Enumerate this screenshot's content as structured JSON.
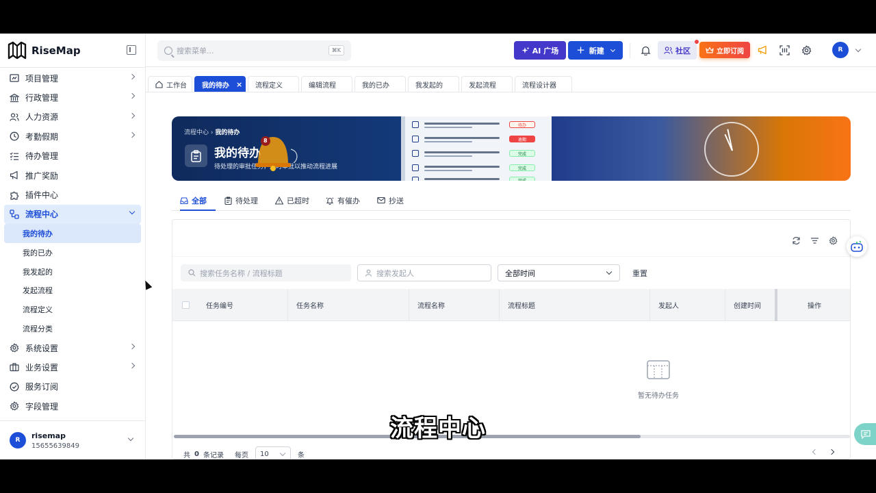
{
  "app": {
    "name": "RiseMap"
  },
  "sidebar": {
    "items": [
      {
        "label": "项目管理",
        "icon": "project-icon"
      },
      {
        "label": "行政管理",
        "icon": "bank-icon"
      },
      {
        "label": "人力资源",
        "icon": "users-icon"
      },
      {
        "label": "考勤假期",
        "icon": "clock-icon"
      },
      {
        "label": "待办管理",
        "icon": "checklist-icon"
      },
      {
        "label": "推广奖励",
        "icon": "megaphone-icon"
      },
      {
        "label": "插件中心",
        "icon": "puzzle-icon"
      },
      {
        "label": "流程中心",
        "icon": "flow-icon"
      }
    ],
    "flow_sub": [
      "我的待办",
      "我的已办",
      "我发起的",
      "发起流程",
      "流程定义",
      "流程分类"
    ],
    "bottom_items": [
      {
        "label": "系统设置",
        "icon": "gear-icon"
      },
      {
        "label": "业务设置",
        "icon": "briefcase-icon"
      },
      {
        "label": "服务订阅",
        "icon": "check-circle-icon"
      },
      {
        "label": "字段管理",
        "icon": "gear-icon"
      }
    ],
    "user": {
      "avatar": "R",
      "name": "risemap",
      "phone": "15655639849"
    }
  },
  "header": {
    "search_placeholder": "搜索菜单...",
    "search_shortcut": "⌘K",
    "ai_button": "AI 广场",
    "new_button": "新建",
    "community_button": "社区",
    "subscribe_button": "立即订阅",
    "avatar": "R"
  },
  "tabs": [
    "工作台",
    "我的待办",
    "流程定义",
    "编辑流程",
    "我的已办",
    "我发起的",
    "发起流程",
    "流程设计器"
  ],
  "banner": {
    "crumb_parent": "流程中心",
    "crumb_current": "我的待办",
    "title": "我的待办",
    "subtitle": "待处理的审批任务，及时审批以推动流程进展",
    "bell_badge": "8",
    "tags": [
      "待办",
      "逾期",
      "完成",
      "完成",
      "完成"
    ]
  },
  "filter_tabs": [
    "全部",
    "待处理",
    "已超时",
    "有催办",
    "抄送"
  ],
  "filters": {
    "task_placeholder": "搜索任务名称 / 流程标题",
    "initiator_placeholder": "搜索发起人",
    "time_select": "全部时间",
    "reset": "重置"
  },
  "table": {
    "columns": [
      "任务编号",
      "任务名称",
      "流程名称",
      "流程标题",
      "发起人",
      "创建时间",
      "操作"
    ],
    "empty_text": "暂无待办任务"
  },
  "pager": {
    "total_prefix": "共",
    "total": "0",
    "total_suffix": "条记录",
    "per_page_label": "每页",
    "per_page": "10",
    "per_page_suffix": "条"
  },
  "caption": "流程中心",
  "colors": {
    "primary": "#1d4ed8",
    "ai": "#4338ca",
    "subscribe": "#f97316"
  }
}
